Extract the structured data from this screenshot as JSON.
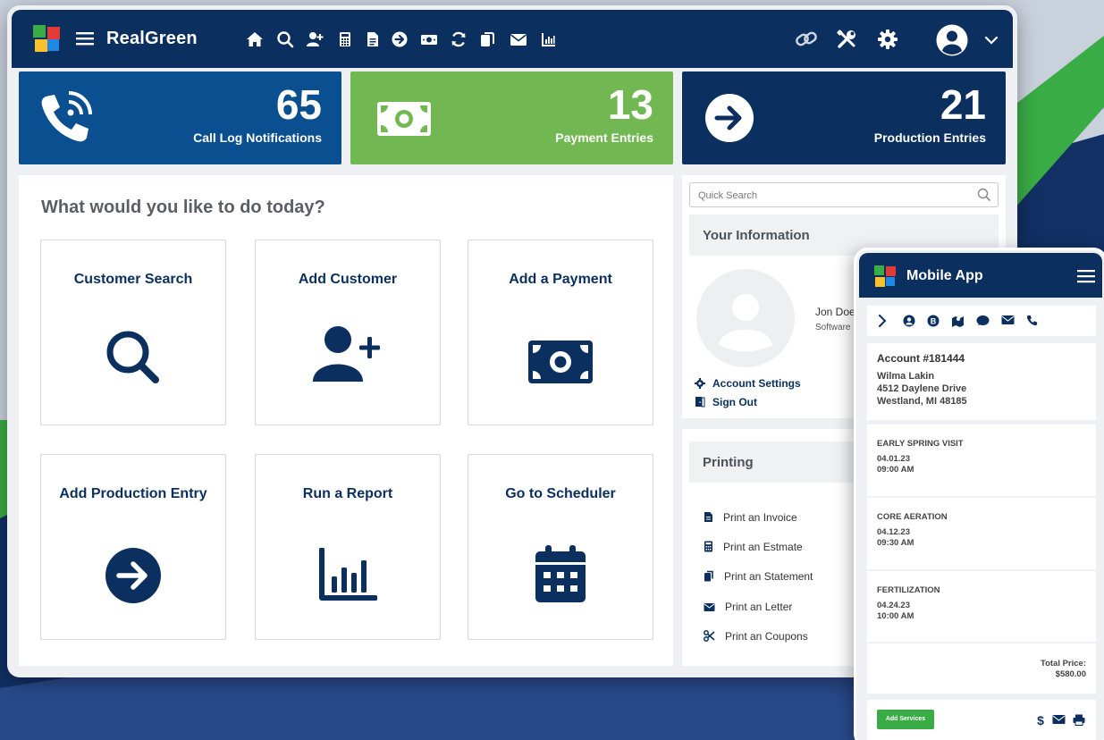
{
  "app": {
    "brand": "RealGreen"
  },
  "colors": {
    "navy": "#0b2f5f",
    "blue": "#0a4f8f",
    "green": "#72b852",
    "accent_green": "#3aac45"
  },
  "nav_icons": [
    "home-icon",
    "search-icon",
    "add-user-icon",
    "calculator-icon",
    "document-icon",
    "arrow-circle-icon",
    "money-icon",
    "refresh-icon",
    "copy-icon",
    "mail-icon",
    "chart-icon",
    "link-icon",
    "tools-icon",
    "gear-icon",
    "user-avatar-icon",
    "chevron-down-icon"
  ],
  "stats": [
    {
      "value": "65",
      "label": "Call Log Notifications"
    },
    {
      "value": "13",
      "label": "Payment Entries"
    },
    {
      "value": "21",
      "label": "Production Entries"
    }
  ],
  "main": {
    "question": "What would you like to do today?",
    "actions": [
      {
        "label": "Customer Search",
        "icon": "search-icon"
      },
      {
        "label": "Add Customer",
        "icon": "add-user-icon"
      },
      {
        "label": "Add a Payment",
        "icon": "money-icon"
      },
      {
        "label": "Add Production Entry",
        "icon": "arrow-circle-icon"
      },
      {
        "label": "Run a Report",
        "icon": "chart-icon"
      },
      {
        "label": "Go to Scheduler",
        "icon": "calendar-icon"
      }
    ]
  },
  "right": {
    "search_placeholder": "Quick Search",
    "info_title": "Your Information",
    "user_name": "Jon Doe",
    "user_role": "Software",
    "account_settings": "Account Settings",
    "sign_out": "Sign Out",
    "printing_title": "Printing",
    "print_items": [
      "Print an Invoice",
      "Print an Estmate",
      "Print an Statement",
      "Print an Letter",
      "Print an Coupons"
    ]
  },
  "mobile": {
    "title": "Mobile App",
    "account": "Account #181444",
    "customer_name": "Wilma Lakin",
    "address_line1": "4512 Daylene Drive",
    "address_line2": "Westland, MI 48185",
    "services": [
      {
        "name": "EARLY SPRING VISIT",
        "date": "04.01.23",
        "time": "09:00 AM"
      },
      {
        "name": "CORE AERATION",
        "date": "04.12.23",
        "time": "09:30 AM"
      },
      {
        "name": "FERTILIZATION",
        "date": "04.24.23",
        "time": "10:00 AM"
      }
    ],
    "total_label": "Total Price:",
    "total_value": "$580.00",
    "add_services": "Add Services"
  }
}
